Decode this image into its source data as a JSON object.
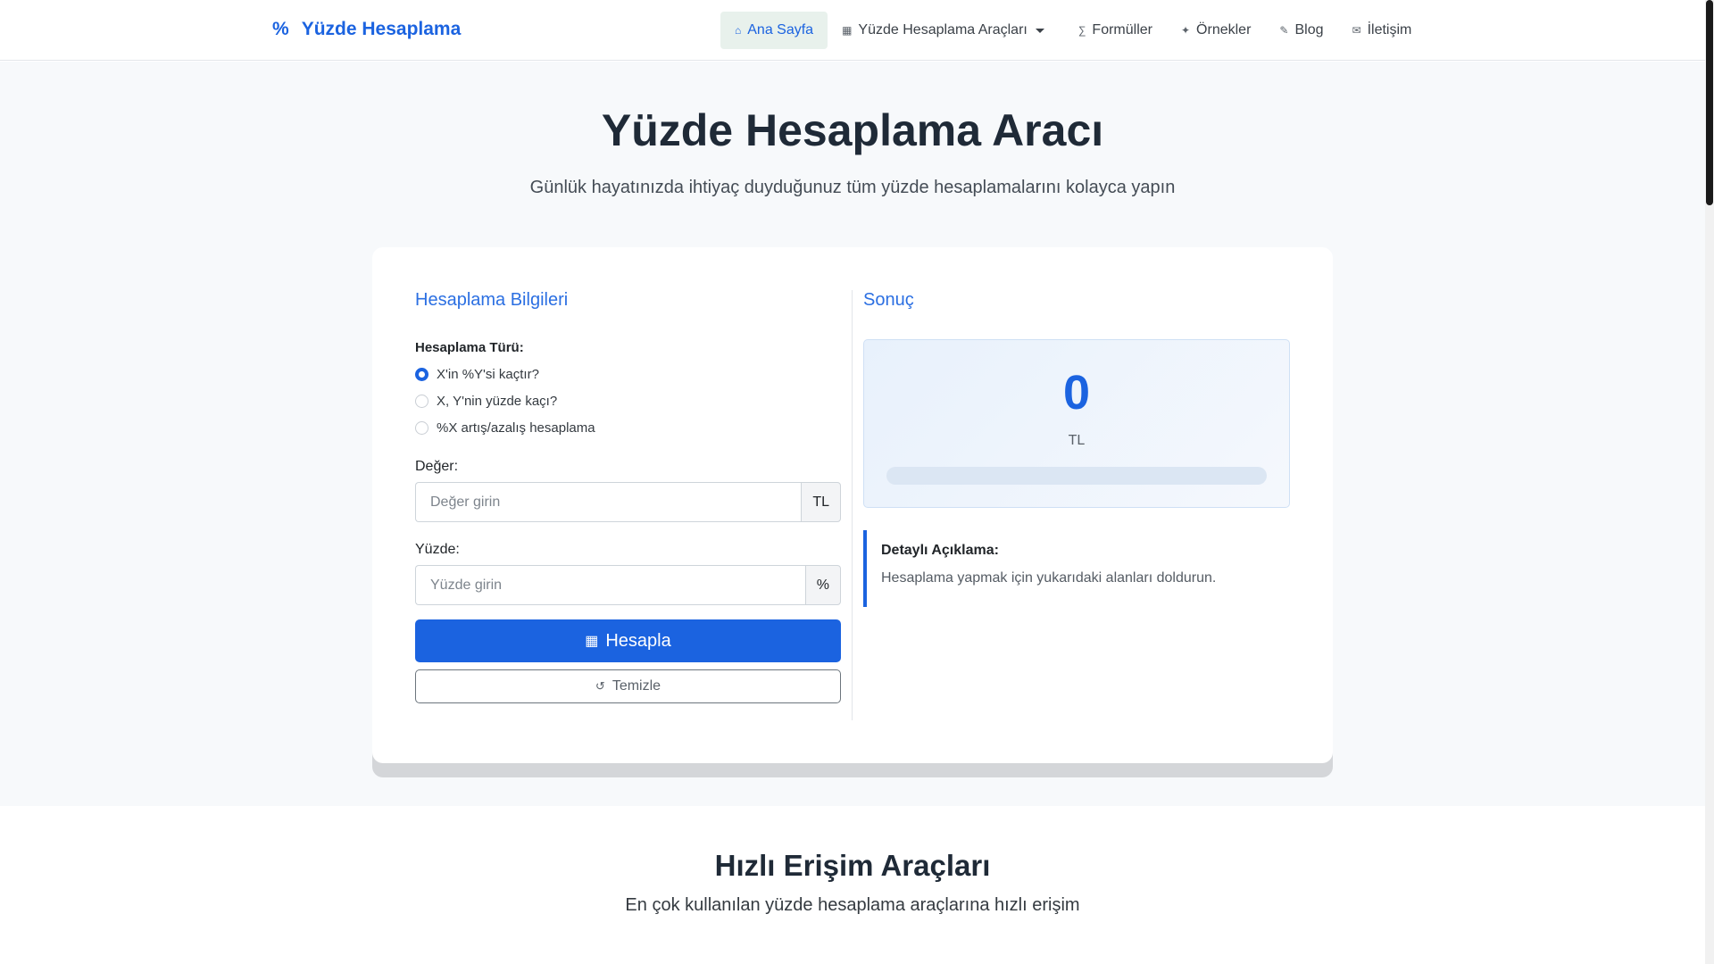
{
  "nav": {
    "brand": "Yüzde Hesaplama",
    "brand_icon": "%",
    "items": [
      {
        "label": "Ana Sayfa",
        "icon": "home-icon"
      },
      {
        "label": "Yüzde Hesaplama Araçları",
        "icon": "calculator-icon"
      },
      {
        "label": "Formüller",
        "icon": "formula-icon"
      },
      {
        "label": "Örnekler",
        "icon": "lightbulb-icon"
      },
      {
        "label": "Blog",
        "icon": "blog-icon"
      },
      {
        "label": "İletişim",
        "icon": "envelope-icon"
      }
    ]
  },
  "hero": {
    "title": "Yüzde Hesaplama Aracı",
    "subtitle": "Günlük hayatınızda ihtiyaç duyduğunuz tüm yüzde hesaplamalarını kolayca yapın"
  },
  "form": {
    "heading": "Hesaplama Bilgileri",
    "type_label": "Hesaplama Türü:",
    "options": [
      {
        "label": "X'in %Y'si kaçtır?",
        "checked": true
      },
      {
        "label": "X, Y'nin yüzde kaçı?",
        "checked": false
      },
      {
        "label": "%X artış/azalış hesaplama",
        "checked": false
      }
    ],
    "value_label": "Değer:",
    "value_placeholder": "Değer girin",
    "value_addon": "TL",
    "percent_label": "Yüzde:",
    "percent_placeholder": "Yüzde girin",
    "percent_addon": "%",
    "calculate_label": "Hesapla",
    "clear_label": "Temizle"
  },
  "result": {
    "heading": "Sonuç",
    "value": "0",
    "unit": "TL",
    "progress_percent": 0,
    "explain_title": "Detaylı Açıklama:",
    "explain_text": "Hesaplama yapmak için yukarıdaki alanları doldurun."
  },
  "quick": {
    "title": "Hızlı Erişim Araçları",
    "subtitle": "En çok kullanılan yüzde hesaplama araçlarına hızlı erişim"
  },
  "colors": {
    "primary": "#1b63e0",
    "nav_active_bg": "#e8f1ec",
    "hero_bg": "#f7f9fb"
  }
}
